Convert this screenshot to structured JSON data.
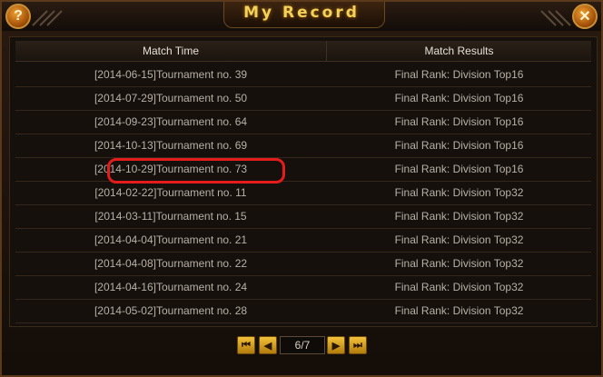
{
  "window": {
    "title": "My Record",
    "help_glyph": "?",
    "close_glyph": "✕"
  },
  "table": {
    "headers": [
      "Match Time",
      "Match Results"
    ],
    "rows": [
      {
        "time": "[2014-06-15]Tournament no. 39",
        "result": "Final Rank: Division Top16"
      },
      {
        "time": "[2014-07-29]Tournament no. 50",
        "result": "Final Rank: Division Top16"
      },
      {
        "time": "[2014-09-23]Tournament no. 64",
        "result": "Final Rank: Division Top16"
      },
      {
        "time": "[2014-10-13]Tournament no. 69",
        "result": "Final Rank: Division Top16"
      },
      {
        "time": "[2014-10-29]Tournament no. 73",
        "result": "Final Rank: Division Top16"
      },
      {
        "time": "[2014-02-22]Tournament no. 11",
        "result": "Final Rank: Division Top32"
      },
      {
        "time": "[2014-03-11]Tournament no. 15",
        "result": "Final Rank: Division Top32"
      },
      {
        "time": "[2014-04-04]Tournament no. 21",
        "result": "Final Rank: Division Top32"
      },
      {
        "time": "[2014-04-08]Tournament no. 22",
        "result": "Final Rank: Division Top32"
      },
      {
        "time": "[2014-04-16]Tournament no. 24",
        "result": "Final Rank: Division Top32"
      },
      {
        "time": "[2014-05-02]Tournament no. 28",
        "result": "Final Rank: Division Top32"
      }
    ],
    "highlighted_row": 4
  },
  "pagination": {
    "page_text": "6/7",
    "buttons": {
      "first": "⏮",
      "prev": "◀",
      "next": "▶",
      "last": "⏭"
    }
  },
  "colors": {
    "title": "#f3d25a",
    "highlight": "#e51c1c",
    "text": "#b7b0a8"
  }
}
